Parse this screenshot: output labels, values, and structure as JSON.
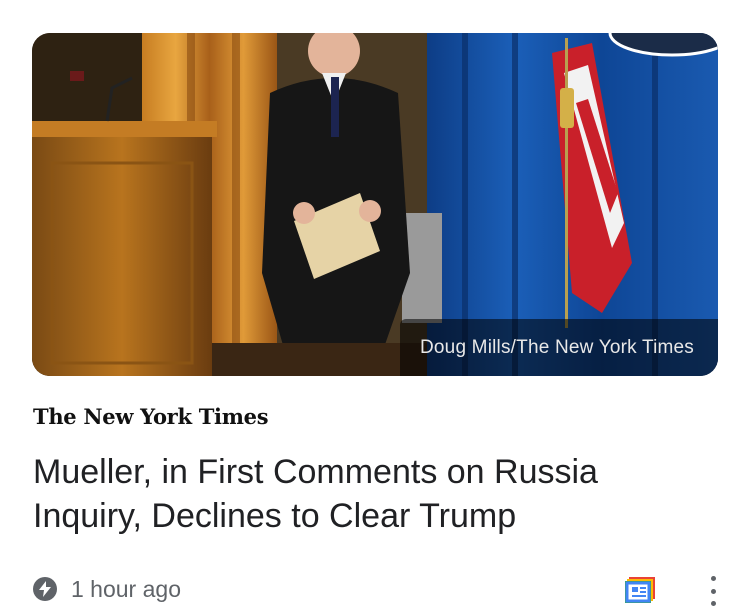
{
  "article": {
    "photo_credit": "Doug Mills/The New York Times",
    "publisher": "The New York Times",
    "headline": "Mueller, in First Comments on Russia Inquiry, Declines to Clear Trump",
    "timestamp": "1 hour ago"
  },
  "icons": {
    "timestamp_icon": "bolt-icon",
    "coverage_icon": "full-coverage-icon",
    "menu_icon": "more-vert-icon"
  },
  "colors": {
    "headline": "#202124",
    "meta": "#5f6368",
    "coverage_blue": "#4285f4",
    "coverage_red": "#ea4335",
    "coverage_yellow": "#fbbc04",
    "coverage_green": "#34a853"
  }
}
